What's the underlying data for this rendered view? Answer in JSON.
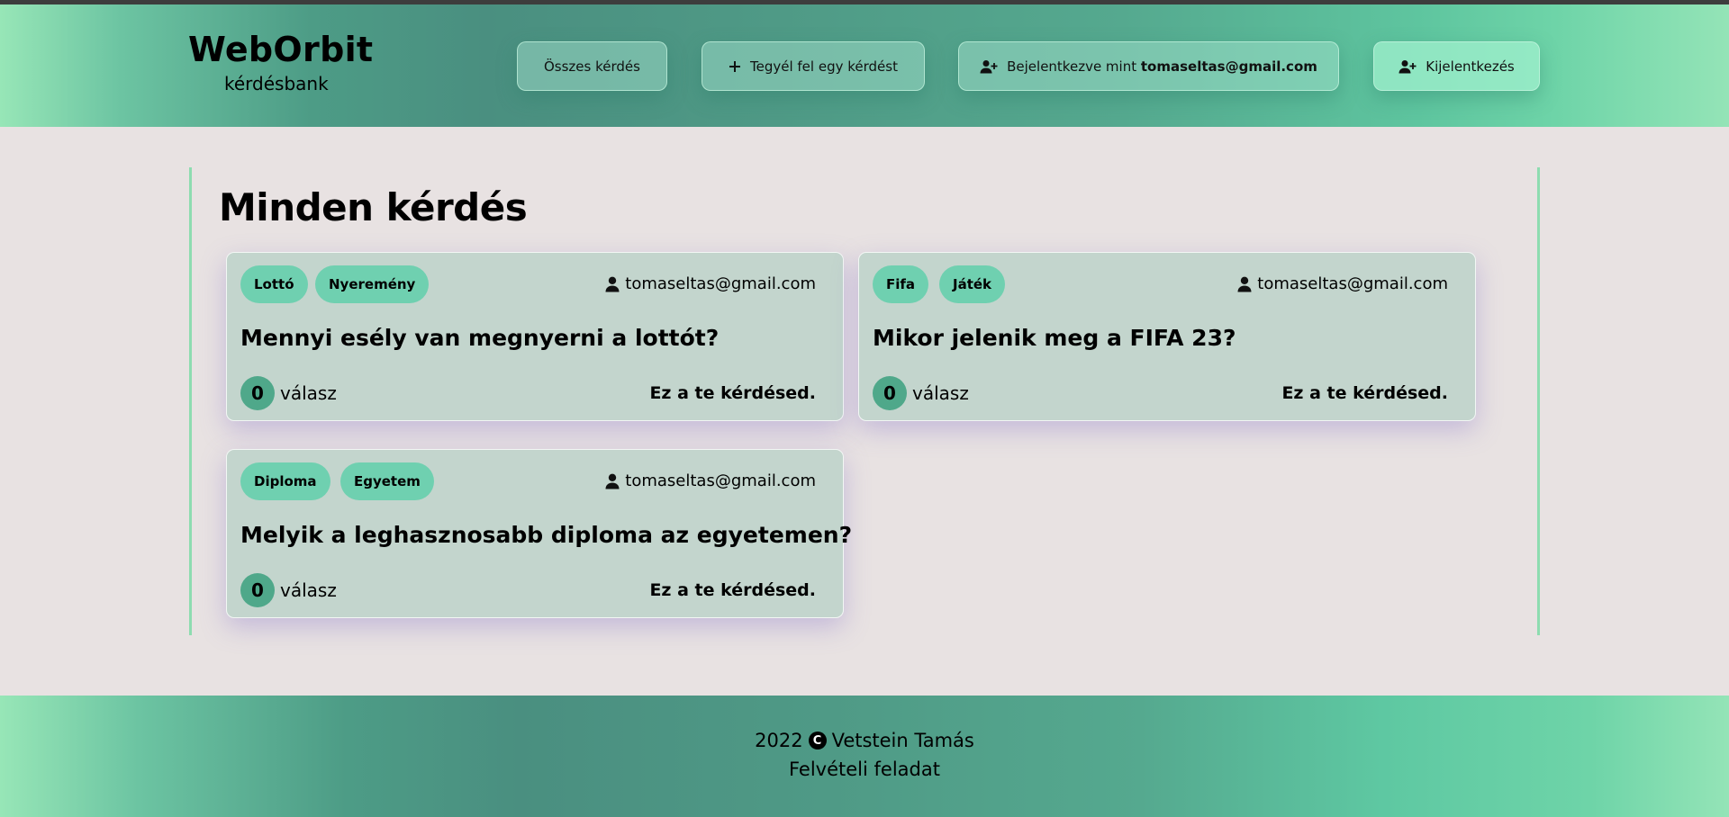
{
  "brand": {
    "title": "WebOrbit",
    "subtitle": "kérdésbank"
  },
  "nav": {
    "all_questions": "Összes kérdés",
    "ask_question": "Tegyél fel egy kérdést",
    "logged_in_prefix": "Bejelentkezve mint",
    "logged_in_user": "tomaseltas@gmail.com",
    "logout": "Kijelentkezés"
  },
  "page": {
    "title": "Minden kérdés"
  },
  "questions": [
    {
      "tags": [
        "Lottó",
        "Nyeremény"
      ],
      "author": "tomaseltas@gmail.com",
      "title": "Mennyi esély van megnyerni a lottót?",
      "answer_count": "0",
      "answer_label": "válasz",
      "ownership": "Ez a te kérdésed."
    },
    {
      "tags": [
        "Fifa",
        "Játék"
      ],
      "author": "tomaseltas@gmail.com",
      "title": "Mikor jelenik meg a FIFA 23?",
      "answer_count": "0",
      "answer_label": "válasz",
      "ownership": "Ez a te kérdésed."
    },
    {
      "tags": [
        "Diploma",
        "Egyetem"
      ],
      "author": "tomaseltas@gmail.com",
      "title": "Melyik a leghasznosabb diploma az egyetemen?",
      "answer_count": "0",
      "answer_label": "válasz",
      "ownership": "Ez a te kérdésed."
    }
  ],
  "footer": {
    "year": "2022",
    "copyright_symbol": "C",
    "author": "Vetstein Tamás",
    "note": "Felvételi feladat"
  },
  "icons": {
    "plus": "plus-icon",
    "user_plus": "user-plus-icon",
    "user": "user-icon",
    "copyright": "copyright-icon"
  },
  "colors": {
    "tag": "#6fd0b0",
    "card": "#c3d5cd",
    "count_badge": "#4fa88a",
    "page_bg": "#e8e2e2"
  }
}
